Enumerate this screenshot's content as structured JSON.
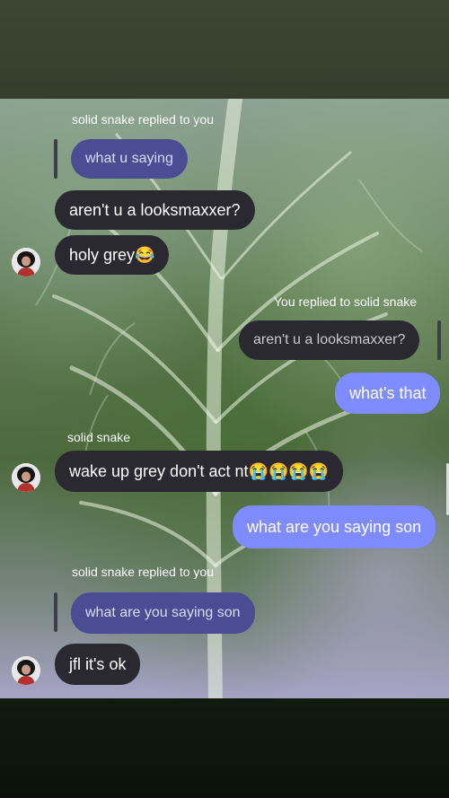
{
  "messages": {
    "reply1_label": "solid snake replied to you",
    "reply1_quote": "what u saying",
    "msg1": "aren't u a looksmaxxer?",
    "msg2": "holy grey😂",
    "my_reply_label": "You replied to solid snake",
    "my_reply_quote": "aren't u a looksmaxxer?",
    "my_msg1": "what's that",
    "sender_label": "solid snake",
    "msg3": "wake up grey don't act nt😭😭😭😭",
    "my_msg2": "what are you saying son",
    "reply2_label": "solid snake replied to you",
    "reply2_quote": "what are you saying son",
    "msg4": "jfl it's ok"
  },
  "colors": {
    "outgoing_bubble": "#7f8cff",
    "incoming_bubble": "#2a2830",
    "reply_quote_in": "#4a4d94"
  },
  "icons": {
    "avatar": "user-avatar"
  }
}
